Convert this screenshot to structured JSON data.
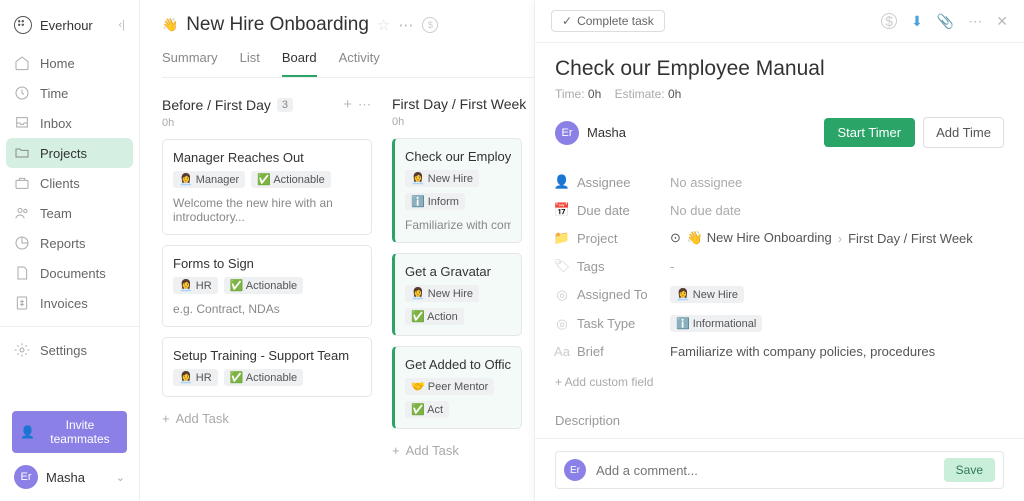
{
  "brand": "Everhour",
  "nav": {
    "home": "Home",
    "time": "Time",
    "inbox": "Inbox",
    "projects": "Projects",
    "clients": "Clients",
    "team": "Team",
    "reports": "Reports",
    "documents": "Documents",
    "invoices": "Invoices",
    "settings": "Settings"
  },
  "invite_label": "Invite teammates",
  "user": {
    "initials": "Er",
    "name": "Masha"
  },
  "project": {
    "emoji": "👋",
    "title": "New Hire Onboarding"
  },
  "tabs": {
    "summary": "Summary",
    "list": "List",
    "board": "Board",
    "activity": "Activity"
  },
  "columns": [
    {
      "title": "Before / First Day",
      "count": "3",
      "time": "0h",
      "cards": [
        {
          "title": "Manager Reaches Out",
          "tags": [
            "👩‍💼 Manager",
            "✅ Actionable"
          ],
          "desc": "Welcome the new hire with an introductory...",
          "accent": false
        },
        {
          "title": "Forms to Sign",
          "tags": [
            "👩‍💼 HR",
            "✅ Actionable"
          ],
          "desc": "e.g. Contract, NDAs",
          "accent": false
        },
        {
          "title": "Setup Training - Support Team",
          "tags": [
            "👩‍💼 HR",
            "✅ Actionable"
          ],
          "desc": "",
          "accent": false
        }
      ]
    },
    {
      "title": "First Day / First Week",
      "count": "",
      "time": "0h",
      "cards": [
        {
          "title": "Check our Employee M",
          "tags": [
            "👩‍💼 New Hire",
            "ℹ️ Inform"
          ],
          "desc": "Familiarize with company",
          "accent": true
        },
        {
          "title": "Get a Gravatar",
          "tags": [
            "👩‍💼 New Hire",
            "✅ Action"
          ],
          "desc": "",
          "accent": true
        },
        {
          "title": "Get Added to Office G",
          "tags": [
            "🤝 Peer Mentor",
            "✅ Act"
          ],
          "desc": "",
          "accent": true
        }
      ]
    }
  ],
  "add_task": "Add Task",
  "panel": {
    "complete": "Complete task",
    "title": "Check our Employee Manual",
    "time_label": "Time:",
    "time_val": "0h",
    "est_label": "Estimate:",
    "est_val": "0h",
    "user_initials": "Er",
    "user_name": "Masha",
    "start_timer": "Start Timer",
    "add_time": "Add Time",
    "fields": {
      "assignee_l": "Assignee",
      "assignee_v": "No assignee",
      "due_l": "Due date",
      "due_v": "No due date",
      "project_l": "Project",
      "project_v1": "👋 New Hire Onboarding",
      "project_v2": "First Day / First Week",
      "tags_l": "Tags",
      "tags_v": "-",
      "assigned_to_l": "Assigned To",
      "assigned_to_v": "👩‍💼 New Hire",
      "task_type_l": "Task Type",
      "task_type_v": "ℹ️ Informational",
      "brief_l": "Brief",
      "brief_v": "Familiarize with company policies, procedures"
    },
    "add_field": "+ Add custom field",
    "description_l": "Description",
    "comment_ph": "Add a comment...",
    "save": "Save"
  }
}
